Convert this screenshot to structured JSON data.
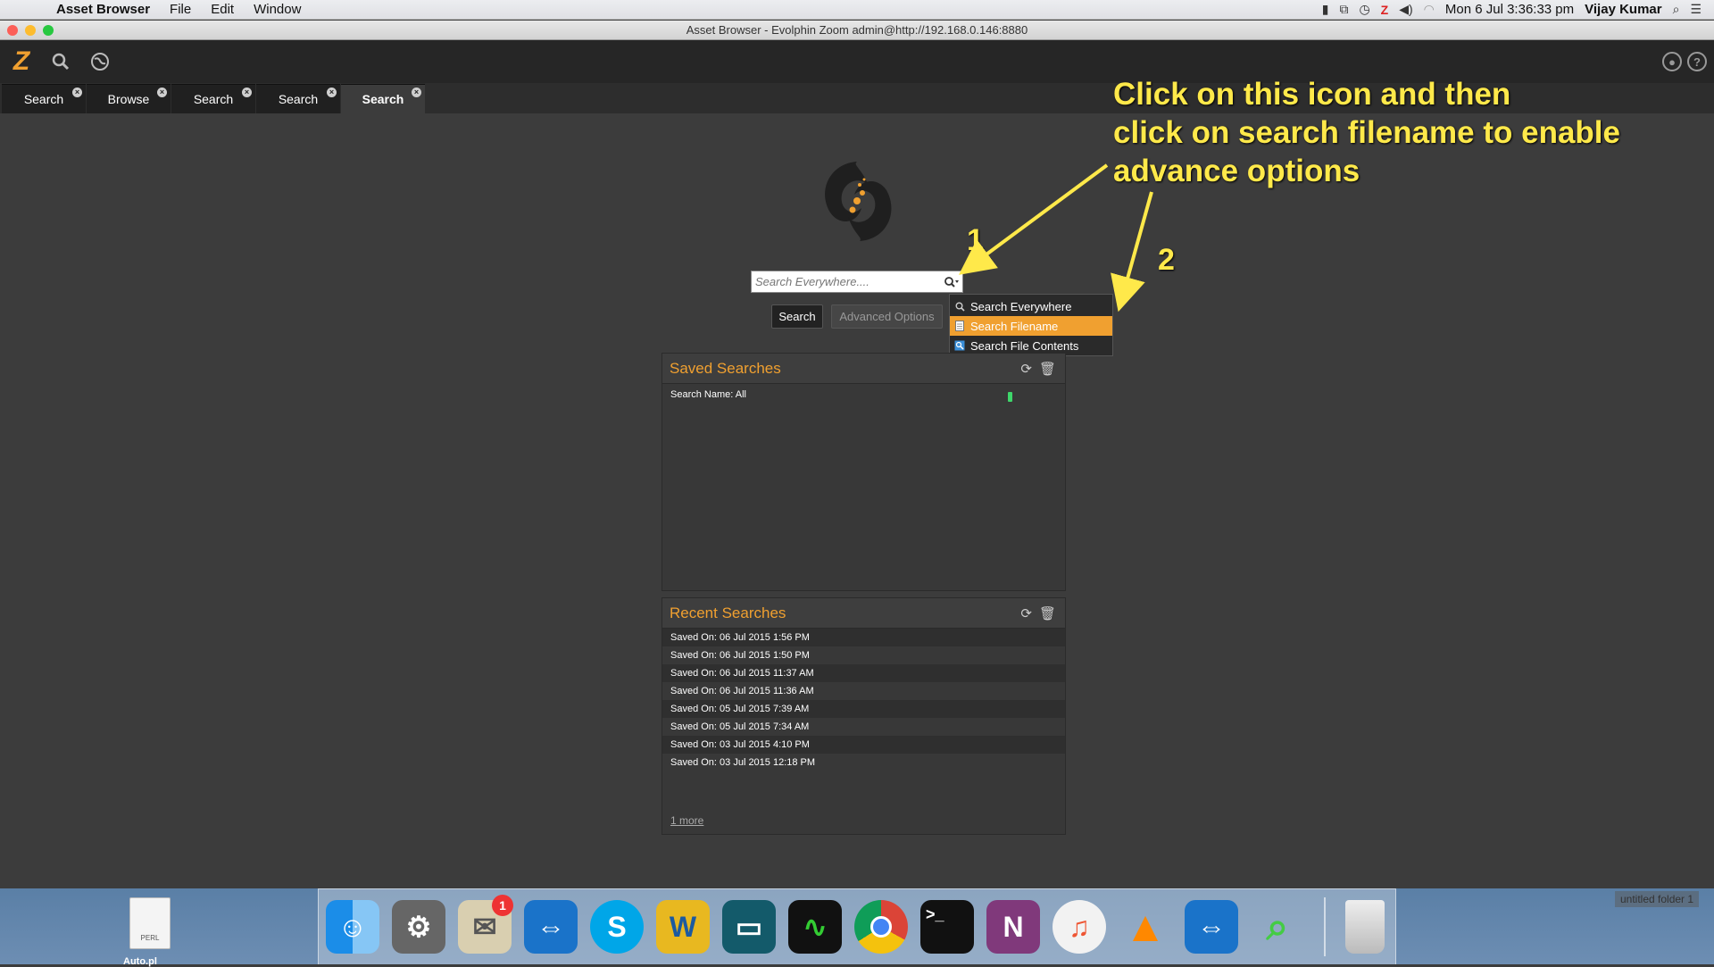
{
  "menubar": {
    "app_name": "Asset Browser",
    "menus": [
      "File",
      "Edit",
      "Window"
    ],
    "clock": "Mon 6 Jul  3:36:33 pm",
    "user": "Vijay Kumar"
  },
  "window": {
    "title": "Asset Browser - Evolphin Zoom admin@http://192.168.0.146:8880"
  },
  "toolbar": {
    "logo_letter": "Z"
  },
  "tabs": [
    {
      "label": "Search",
      "active": false
    },
    {
      "label": "Browse",
      "active": false
    },
    {
      "label": "Search",
      "active": false
    },
    {
      "label": "Search",
      "active": false
    },
    {
      "label": "Search",
      "active": true
    }
  ],
  "search": {
    "placeholder": "Search Everywhere....",
    "search_label": "Search",
    "advanced_label": "Advanced Options"
  },
  "dropdown": {
    "items": [
      {
        "label": "Search Everywhere",
        "icon": "magnifier-icon"
      },
      {
        "label": "Search Filename",
        "icon": "document-icon",
        "selected": true
      },
      {
        "label": "Search File Contents",
        "icon": "content-search-icon"
      }
    ]
  },
  "saved_searches": {
    "title": "Saved Searches",
    "rows": [
      "Search Name: All"
    ]
  },
  "recent_searches": {
    "title": "Recent Searches",
    "rows": [
      "Saved On: 06 Jul 2015 1:56 PM",
      "Saved On: 06 Jul 2015 1:50 PM",
      "Saved On: 06 Jul 2015 11:37 AM",
      "Saved On: 06 Jul 2015 11:36 AM",
      "Saved On: 05 Jul 2015 7:39 AM",
      "Saved On: 05 Jul 2015 7:34 AM",
      "Saved On: 03 Jul 2015 4:10 PM",
      "Saved On: 03 Jul 2015 12:18 PM"
    ],
    "more_label": "1 more"
  },
  "annotation": {
    "line1": "Click on this icon and then",
    "line2": "click on search filename to enable",
    "line3": "advance options",
    "num1": "1",
    "num2": "2"
  },
  "desktop": {
    "file_label": "Auto.pl",
    "file_type": "PERL",
    "folder_label": "untitled folder 1"
  },
  "dock": {
    "mail_badge": "1"
  },
  "colors": {
    "accent": "#f0a030",
    "annotation": "#ffe94a"
  }
}
